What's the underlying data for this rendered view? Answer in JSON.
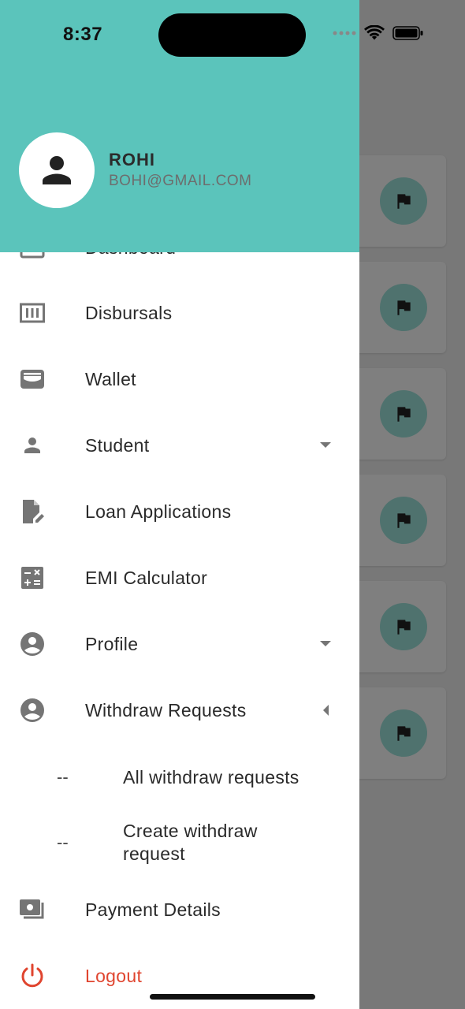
{
  "status_bar": {
    "time": "8:37"
  },
  "user": {
    "name": "ROHI",
    "email": "BOHI@GMAIL.COM"
  },
  "menu": {
    "dashboard": "Dashboard",
    "disbursals": "Disbursals",
    "wallet": "Wallet",
    "student": "Student",
    "loan_applications": "Loan Applications",
    "emi_calculator": "EMI Calculator",
    "profile": "Profile",
    "withdraw_requests": "Withdraw Requests",
    "withdraw_sub": [
      {
        "dash": "--",
        "label": "All withdraw requests"
      },
      {
        "dash": "--",
        "label": "Create withdraw request"
      }
    ],
    "payment_details": "Payment Details",
    "logout": "Logout"
  },
  "colors": {
    "header": "#5bc4bb",
    "logout": "#e0452f",
    "icon": "#757575",
    "flag_circle": "#4f726e"
  },
  "icons": [
    "person-icon",
    "dashboard-icon",
    "disbursals-icon",
    "wallet-icon",
    "student-icon",
    "loan-application-icon",
    "calculator-icon",
    "profile-icon",
    "withdraw-icon",
    "payment-icon",
    "power-icon",
    "flag-icon",
    "caret-down-icon",
    "caret-left-icon"
  ]
}
